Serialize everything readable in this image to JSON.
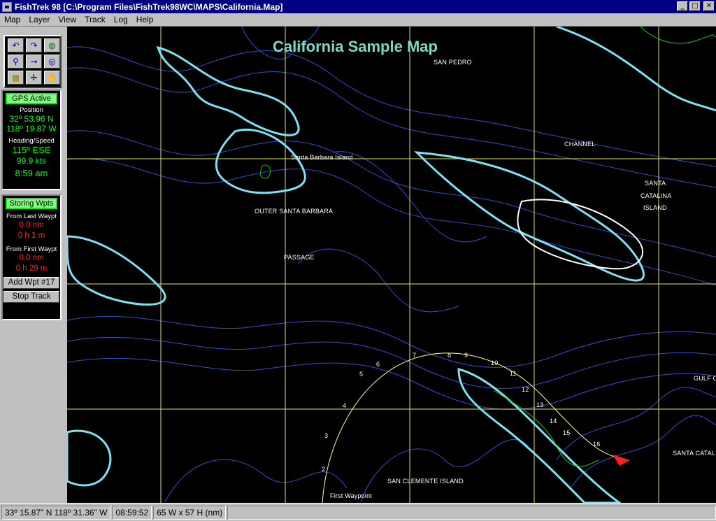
{
  "window": {
    "title": "FishTrek 98 [C:\\Program Files\\FishTrek98WC\\MAPS\\California.Map]",
    "controls": {
      "minimize": "_",
      "maximize": "□",
      "close": "✕"
    }
  },
  "menu": [
    {
      "id": "map",
      "label": "Map"
    },
    {
      "id": "layer",
      "label": "Layer"
    },
    {
      "id": "view",
      "label": "View"
    },
    {
      "id": "track",
      "label": "Track"
    },
    {
      "id": "log",
      "label": "Log"
    },
    {
      "id": "help",
      "label": "Help"
    }
  ],
  "toolbox": [
    {
      "id": "undo",
      "icon": "undo-icon",
      "glyph": "↶"
    },
    {
      "id": "redo",
      "icon": "redo-icon",
      "glyph": "↷"
    },
    {
      "id": "globe",
      "icon": "globe-icon",
      "glyph": "◍"
    },
    {
      "id": "zoom",
      "icon": "magnifier-icon",
      "glyph": "⚲"
    },
    {
      "id": "measure",
      "icon": "measure-icon",
      "glyph": "⊸"
    },
    {
      "id": "gps",
      "icon": "gps-target-icon",
      "glyph": "◎"
    },
    {
      "id": "grid",
      "icon": "grid-icon",
      "glyph": "▦"
    },
    {
      "id": "crosshair",
      "icon": "crosshair-icon",
      "glyph": "✛"
    },
    {
      "id": "pan",
      "icon": "hand-icon",
      "glyph": "✋"
    }
  ],
  "gps": {
    "status": "GPS Active",
    "position_label": "Position",
    "latitude": "32º 53.96 N",
    "longitude": "118º 19.87 W",
    "heading_speed_label": "Heading/Speed",
    "heading": "115º ESE",
    "speed": "99.9 kts",
    "time": "8:59 am"
  },
  "waypoints": {
    "status": "Storing Wpts",
    "from_last_label": "From Last Waypt",
    "from_last_distance": "0.0 nm",
    "from_last_time": "0 h 1 m",
    "from_first_label": "From First Waypt",
    "from_first_distance": "0.0 nm",
    "from_first_time": "0 h 29 m",
    "add_button": "Add Wpt #17",
    "stop_button": "Stop Track"
  },
  "map": {
    "title": "California Sample Map",
    "labels": {
      "san_pedro": "SAN PEDRO",
      "channel": "CHANNEL",
      "santa_barbara_island": "Santa Barbara Island",
      "santa": "SANTA",
      "catalina": "CATALINA",
      "island": "ISLAND",
      "outer_santa_barbara": "OUTER SANTA BARBARA",
      "passage": "PASSAGE",
      "gulf": "GULF O",
      "santa_catal": "SANTA CATAL",
      "san_clemente_island": "SAN CLEMENTE ISLAND",
      "first_waypoint": "First Waypoint"
    },
    "track_waypoints": [
      "2",
      "3",
      "4",
      "5",
      "6",
      "7",
      "8",
      "9",
      "10",
      "11",
      "12",
      "13",
      "14",
      "15",
      "16"
    ],
    "colors": {
      "background": "#000000",
      "grid": "#e0e060",
      "contour": "#3050c8",
      "coast": "#7fe0f0",
      "land": "#20c020",
      "track": "#ffff80",
      "boat": "#ff2020"
    }
  },
  "statusbar": {
    "cursor_position": "33º 15.87\" N 118º 31.36\" W",
    "time": "08:59:52",
    "view_size": "65 W x 57 H (nm)"
  }
}
